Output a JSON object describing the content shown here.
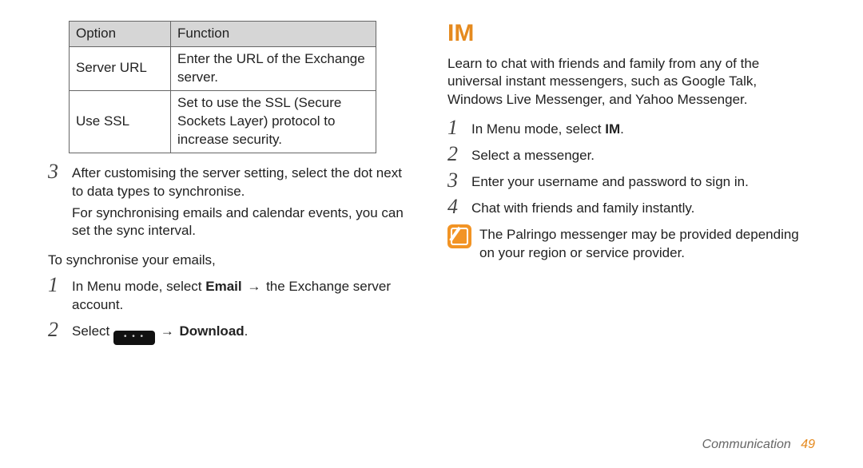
{
  "left": {
    "table": {
      "headers": {
        "option": "Option",
        "function": "Function"
      },
      "rows": [
        {
          "option": "Server URL",
          "function": "Enter the URL of the Exchange server."
        },
        {
          "option": "Use SSL",
          "function": "Set to use the SSL (Secure Sockets Layer) protocol to increase security."
        }
      ]
    },
    "step3_num": "3",
    "step3_text": "After customising the server setting, select the dot next to data types to synchronise.",
    "step3_cont": "For synchronising emails and calendar events, you can set the sync interval.",
    "sync_intro": "To synchronise your emails,",
    "s1_num": "1",
    "s1_a": "In Menu mode, select ",
    "s1_bold": "Email",
    "s1_arrow": " → ",
    "s1_b": "the Exchange server account.",
    "s2_num": "2",
    "s2_a": "Select ",
    "s2_arrow": " → ",
    "s2_bold": "Download",
    "s2_dot": "."
  },
  "right": {
    "heading": "IM",
    "intro": "Learn to chat with friends and family from any of the universal instant messengers, such as Google Talk, Windows Live Messenger, and Yahoo Messenger.",
    "r1_num": "1",
    "r1_a": "In Menu mode, select ",
    "r1_bold": "IM",
    "r1_dot": ".",
    "r2_num": "2",
    "r2": "Select a messenger.",
    "r3_num": "3",
    "r3": "Enter your username and password to sign in.",
    "r4_num": "4",
    "r4": "Chat with friends and family instantly.",
    "note": "The Palringo messenger may be provided depending on your region or service provider."
  },
  "footer": {
    "section": "Communication",
    "page": "49"
  }
}
